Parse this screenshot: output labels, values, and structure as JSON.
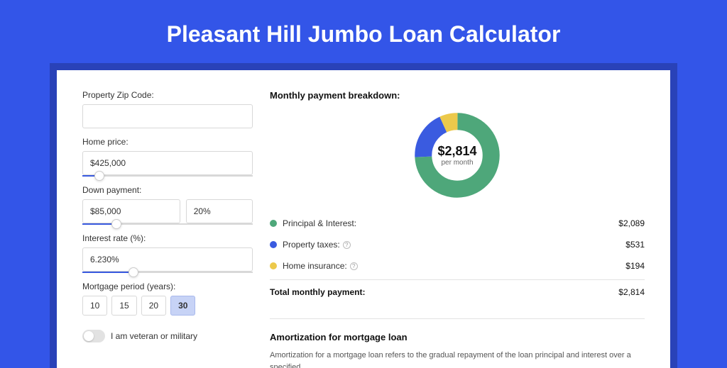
{
  "title": "Pleasant Hill Jumbo Loan Calculator",
  "form": {
    "zip_label": "Property Zip Code:",
    "zip_value": "",
    "home_price_label": "Home price:",
    "home_price_value": "$425,000",
    "down_payment_label": "Down payment:",
    "down_payment_value": "$85,000",
    "down_payment_pct": "20%",
    "interest_label": "Interest rate (%):",
    "interest_value": "6.230%",
    "period_label": "Mortgage period (years):",
    "period_options": [
      "10",
      "15",
      "20",
      "30"
    ],
    "period_selected": "30",
    "veteran_label": "I am veteran or military",
    "veteran_on": false,
    "sliders": {
      "home_price_pct": 10,
      "down_payment_pct": 20,
      "interest_pct": 30
    }
  },
  "breakdown": {
    "section_title": "Monthly payment breakdown:",
    "center_amount": "$2,814",
    "center_sub": "per month",
    "rows": [
      {
        "color": "green",
        "label": "Principal & Interest:",
        "value": "$2,089",
        "info": false
      },
      {
        "color": "blue",
        "label": "Property taxes:",
        "value": "$531",
        "info": true
      },
      {
        "color": "yellow",
        "label": "Home insurance:",
        "value": "$194",
        "info": true
      }
    ],
    "total_label": "Total monthly payment:",
    "total_value": "$2,814"
  },
  "chart_data": {
    "type": "pie",
    "title": "Monthly payment breakdown",
    "series": [
      {
        "name": "Principal & Interest",
        "value": 2089,
        "color": "#4ea77a"
      },
      {
        "name": "Property taxes",
        "value": 531,
        "color": "#3a5be0"
      },
      {
        "name": "Home insurance",
        "value": 194,
        "color": "#ecc94b"
      }
    ],
    "total": 2814,
    "inner_radius_pct": 62
  },
  "amort": {
    "title": "Amortization for mortgage loan",
    "text": "Amortization for a mortgage loan refers to the gradual repayment of the loan principal and interest over a specified"
  }
}
